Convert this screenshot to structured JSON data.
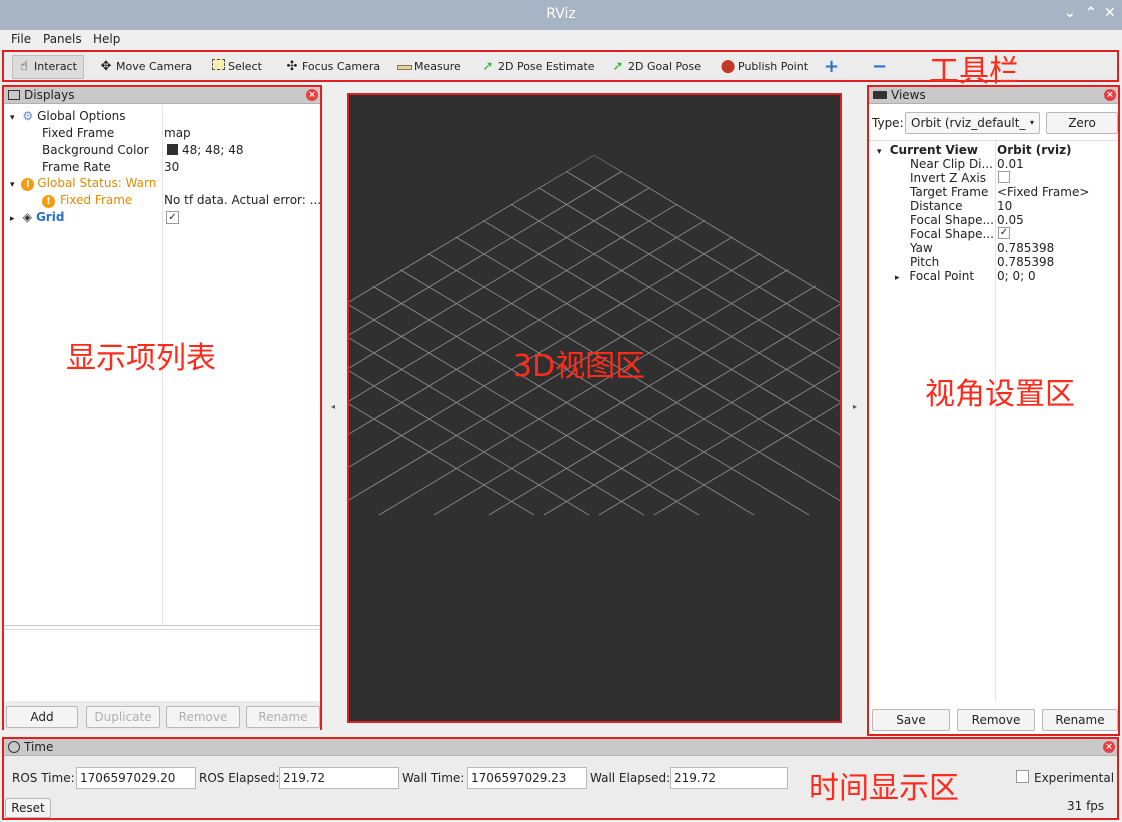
{
  "window": {
    "title": "RViz"
  },
  "menu": {
    "file": "File",
    "panels": "Panels",
    "help": "Help"
  },
  "toolbar": {
    "interact": "Interact",
    "move_camera": "Move Camera",
    "select": "Select",
    "focus_camera": "Focus Camera",
    "measure": "Measure",
    "pose_estimate": "2D Pose Estimate",
    "goal_pose": "2D Goal Pose",
    "publish_point": "Publish Point"
  },
  "annotations": {
    "toolbar": "工具栏",
    "displays": "显示项列表",
    "viewport": "3D视图区",
    "views": "视角设置区",
    "time": "时间显示区"
  },
  "displays": {
    "title": "Displays",
    "global_options": "Global Options",
    "fixed_frame_label": "Fixed Frame",
    "fixed_frame_value": "map",
    "bg_color_label": "Background Color",
    "bg_color_value": "48; 48; 48",
    "frame_rate_label": "Frame Rate",
    "frame_rate_value": "30",
    "global_status": "Global Status: Warn",
    "status_fixed_frame": "Fixed Frame",
    "status_error": "No tf data.  Actual error: ...",
    "grid": "Grid",
    "buttons": {
      "add": "Add",
      "duplicate": "Duplicate",
      "remove": "Remove",
      "rename": "Rename"
    }
  },
  "views": {
    "title": "Views",
    "type_label": "Type:",
    "type_value": "Orbit (rviz_default_",
    "zero": "Zero",
    "current_view_label": "Current View",
    "current_view_value": "Orbit (rviz)",
    "props": [
      {
        "label": "Near Clip Di...",
        "value": "0.01"
      },
      {
        "label": "Invert Z Axis",
        "value": ""
      },
      {
        "label": "Target Frame",
        "value": "<Fixed Frame>"
      },
      {
        "label": "Distance",
        "value": "10"
      },
      {
        "label": "Focal Shape...",
        "value": "0.05"
      },
      {
        "label": "Focal Shape...",
        "value": ""
      },
      {
        "label": "Yaw",
        "value": "0.785398"
      },
      {
        "label": "Pitch",
        "value": "0.785398"
      },
      {
        "label": "Focal Point",
        "value": "0; 0; 0"
      }
    ],
    "buttons": {
      "save": "Save",
      "remove": "Remove",
      "rename": "Rename"
    }
  },
  "time": {
    "title": "Time",
    "ros_time_label": "ROS Time:",
    "ros_time_value": "1706597029.20",
    "ros_elapsed_label": "ROS Elapsed:",
    "ros_elapsed_value": "219.72",
    "wall_time_label": "Wall Time:",
    "wall_time_value": "1706597029.23",
    "wall_elapsed_label": "Wall Elapsed:",
    "wall_elapsed_value": "219.72",
    "experimental": "Experimental",
    "reset": "Reset",
    "fps": "31 fps"
  },
  "colors": {
    "annotation": "#ff2a1a",
    "viewport_bg": "#303030",
    "warn": "#e08a00",
    "grid_link": "#2a6fc9"
  }
}
